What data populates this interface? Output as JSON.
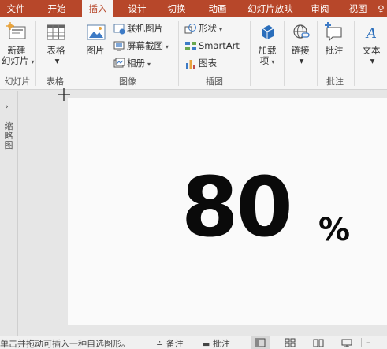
{
  "tabs": [
    "文件",
    "开始",
    "插入",
    "设计",
    "切换",
    "动画",
    "幻灯片放映",
    "审阅",
    "视图",
    "♀"
  ],
  "active_tab": "插入",
  "groups": {
    "slides": {
      "label": "幻灯片",
      "new_slide_line1": "新建",
      "new_slide_line2": "幻灯片"
    },
    "tables": {
      "label": "表格",
      "table": "表格"
    },
    "images": {
      "label": "图像",
      "picture": "图片",
      "online_picture": "联机图片",
      "screenshot": "屏幕截图",
      "album": "相册"
    },
    "illustrations": {
      "label": "插图",
      "shapes": "形状",
      "smartart": "SmartArt",
      "chart": "图表"
    },
    "addins": {
      "label_line1": "加载",
      "label_line2": "项"
    },
    "links": {
      "link": "链接"
    },
    "comments": {
      "label": "批注",
      "comment": "批注"
    },
    "text": {
      "text": "文本"
    }
  },
  "slide": {
    "number": "80",
    "percent": "%"
  },
  "thumb_pane": {
    "collapsed_label": "缩略图"
  },
  "status": {
    "hint": "单击并拖动可插入一种自选图形。",
    "notes": "备注",
    "comments": "批注"
  },
  "colors": {
    "accent": "#b7472a",
    "ribbon_bg": "#f5f5f5",
    "slide_bg": "#fafafa",
    "text": "#0a0a0a"
  }
}
